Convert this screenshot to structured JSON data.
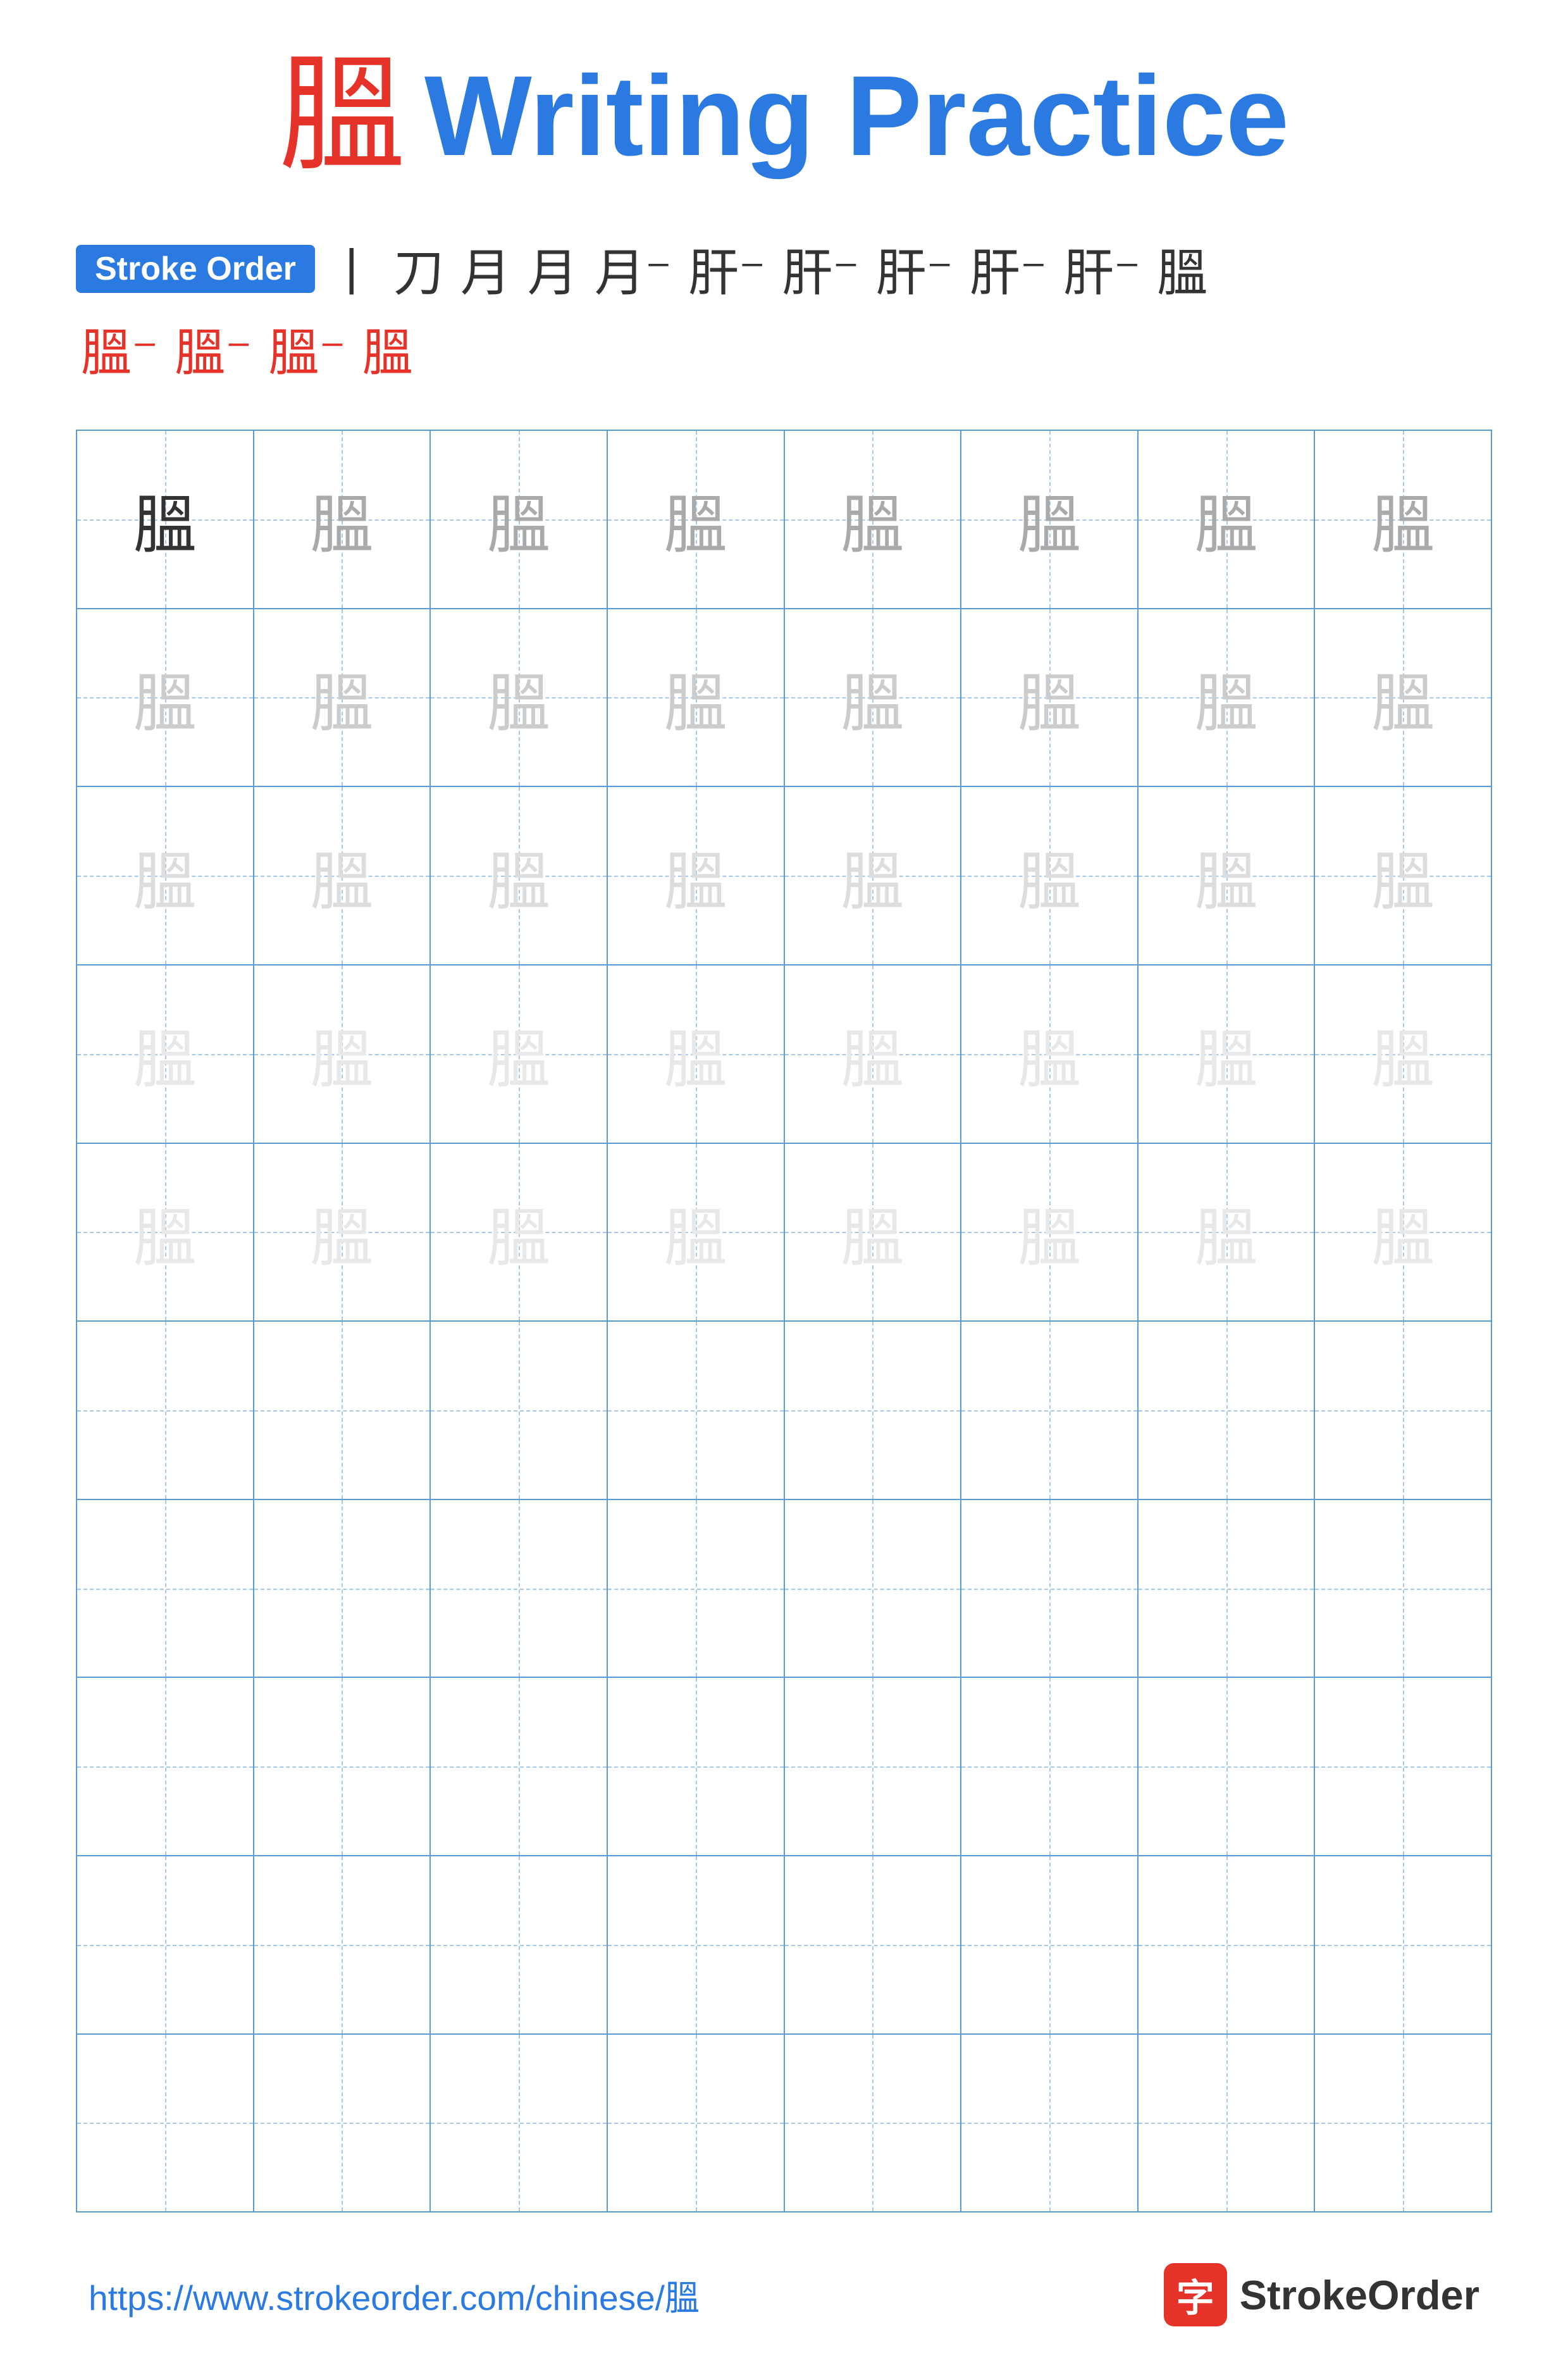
{
  "title": {
    "char": "膃",
    "label": "Writing Practice"
  },
  "stroke_order": {
    "badge_label": "Stroke Order",
    "strokes": [
      "丨",
      "刀",
      "月",
      "月",
      "月⁻",
      "肝",
      "肝⁻",
      "肝⁻",
      "肝⁻",
      "肝⁻",
      "膃",
      "膃⁻",
      "膃⁻",
      "膃⁻"
    ]
  },
  "grid": {
    "rows": 10,
    "cols": 8,
    "char": "膃",
    "practice_rows": 5,
    "empty_rows": 5
  },
  "footer": {
    "url": "https://www.strokeorder.com/chinese/膃",
    "logo_text": "StrokeOrder",
    "logo_icon": "字"
  }
}
